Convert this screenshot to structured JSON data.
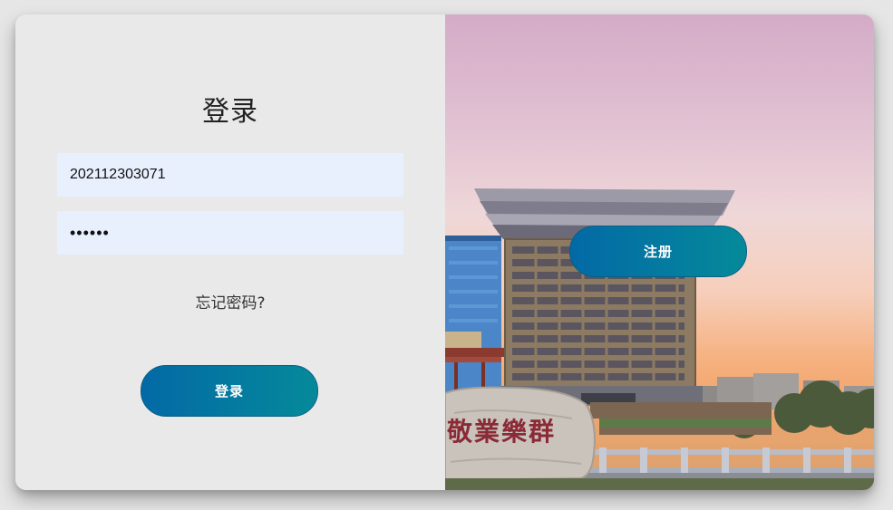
{
  "login": {
    "title": "登录",
    "username_value": "202112303071",
    "password_value": "••••••",
    "forgot_label": "忘记密码?",
    "login_button_label": "登录"
  },
  "right_panel": {
    "register_button_label": "注册",
    "stone_inscription": "敬業樂群"
  },
  "colors": {
    "button_gradient_start": "#0369a6",
    "button_gradient_end": "#058a9a",
    "input_background": "#e8f0fe",
    "panel_background": "#e9e9e9"
  }
}
